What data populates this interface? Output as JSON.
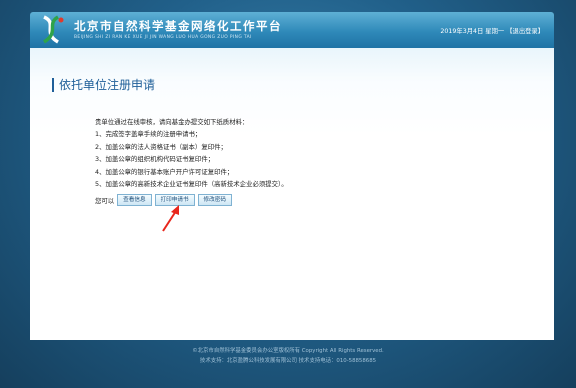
{
  "header": {
    "title": "北京市自然科学基金网络化工作平台",
    "pinyin": "BEIJING SHI ZI RAN KE XUE JI JIN WANG LUO HUA GONG ZUO PING TAI",
    "date": "2019年3月4日 星期一",
    "logout_label": "【退出登录】",
    "logo_icon": "dna-helix-logo-icon"
  },
  "main": {
    "page_title": "依托单位注册申请",
    "notice_lines": [
      "贵单位通过在线审核，请向基金办提交如下纸质材料：",
      "1、完成签字盖章手续的注册申请书；",
      "2、加盖公章的法人资格证书（副本）复印件；",
      "3、加盖公章的组织机构代码证书复印件；",
      "4、加盖公章的银行基本账户开户许可证复印件；",
      "5、加盖公章的高新技术企业证书复印件（高新技术企业必须提交）。"
    ],
    "actions_prefix": "您可以",
    "buttons": {
      "view_info": "查看信息",
      "print_application": "打印申请书",
      "change_password": "修改密码"
    }
  },
  "footer": {
    "copyright": "©北京市自然科学基金委员会办公室版权所有 Copyright All Rights Reserved.",
    "support": "技术支持：北京盈腾公科技发展有限公司 技术支持电话：010-58858685"
  },
  "colors": {
    "page_background": "#1b4f6f",
    "header_blue": "#2f89b9",
    "title_blue": "#1f5f99",
    "arrow_red": "#e8261c"
  }
}
